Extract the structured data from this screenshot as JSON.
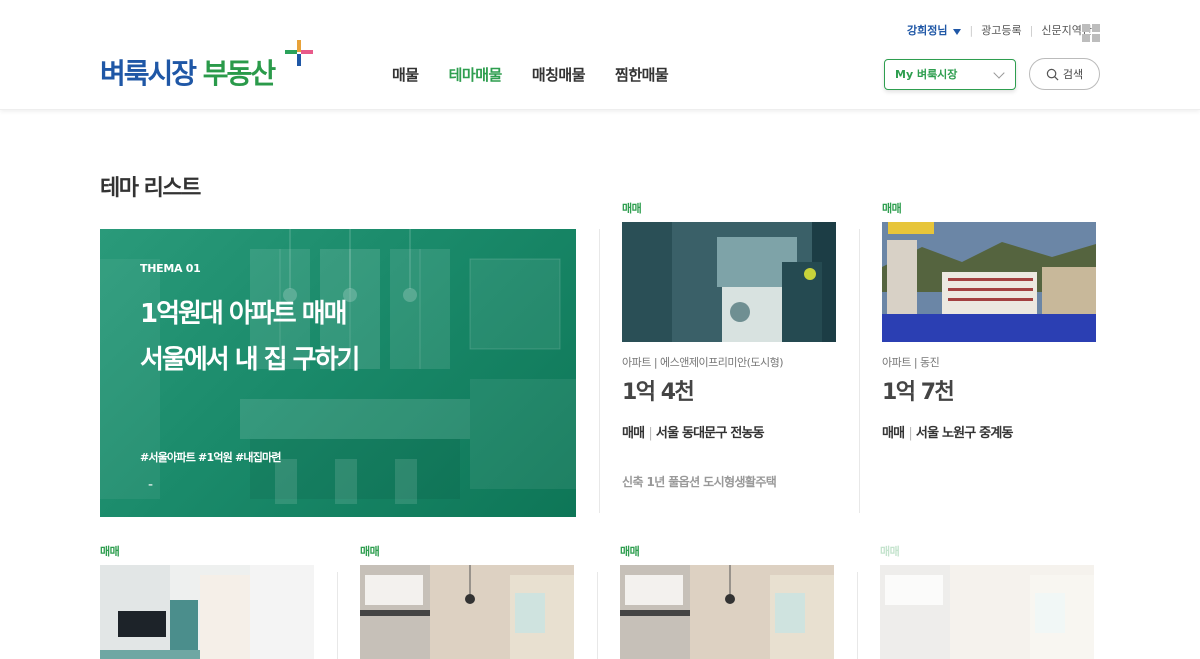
{
  "header": {
    "logo_part1": "벼룩시장",
    "logo_part2": "부동산",
    "nav": [
      {
        "label": "매물",
        "active": false
      },
      {
        "label": "테마매물",
        "active": true
      },
      {
        "label": "매칭매물",
        "active": false
      },
      {
        "label": "찜한매물",
        "active": false
      }
    ],
    "user_name": "강희정님",
    "util_links": [
      "광고등록",
      "신문지역판"
    ],
    "my_select_value": "My 벼룩시장",
    "search_label": "검색",
    "accent_color": "#2e9e4f",
    "brand_blue": "#1f57a6"
  },
  "main": {
    "section_title": "테마 리스트",
    "feature": {
      "label": "THEMA 01",
      "headline_line1": "1억원대 아파트 매매",
      "headline_line2": "서울에서 내 집 구하기",
      "tags": "#서울아파트 #1억원 #내집마련",
      "dash": "-"
    },
    "cards_row1": [
      {
        "badge": "매매",
        "category": "아파트 | 에스앤제이프리미안(도시형)",
        "price": "1억 4천",
        "deal": "매매",
        "address": "서울 동대문구 전농동",
        "desc": "신축 1년 풀옵션 도시형생활주택"
      },
      {
        "badge": "매매",
        "category": "아파트 | 동진",
        "price": "1억 7천",
        "deal": "매매",
        "address": "서울 노원구 중계동",
        "desc": ""
      }
    ],
    "cards_row2": [
      {
        "badge": "매매"
      },
      {
        "badge": "매매"
      },
      {
        "badge": "매매"
      },
      {
        "badge": "매매"
      }
    ]
  }
}
